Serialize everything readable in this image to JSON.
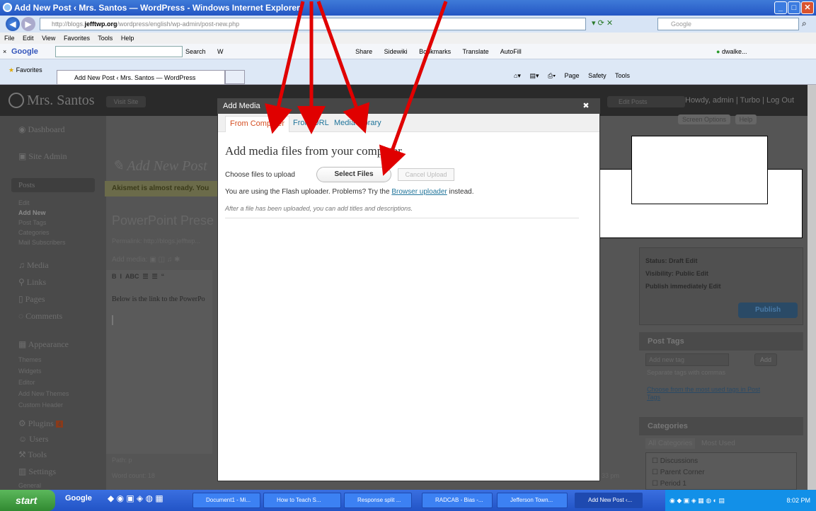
{
  "window": {
    "title": "Add New Post ‹ Mrs. Santos — WordPress - Windows Internet Explorer"
  },
  "address": {
    "prefix": "http://blogs.",
    "domain": "jefftwp.org",
    "path": "/wordpress/english/wp-admin/post-new.php",
    "search_placeholder": "Google"
  },
  "menu": [
    "File",
    "Edit",
    "View",
    "Favorites",
    "Tools",
    "Help"
  ],
  "google_toolbar": {
    "logo": "Google",
    "items": [
      "Search",
      "W",
      "Share",
      "Sidewiki",
      "Bookmarks",
      "Translate",
      "AutoFill"
    ],
    "user": "dwalke..."
  },
  "favorites": {
    "label": "Favorites",
    "tab": "Add New Post ‹ Mrs. Santos — WordPress",
    "commands": [
      "Page",
      "Safety",
      "Tools"
    ]
  },
  "wp": {
    "site_name": "Mrs. Santos",
    "visit_site": "Visit Site",
    "edit_posts": "Edit Posts",
    "howdy": "Howdy, admin | Turbo | Log Out",
    "screen_options": "Screen Options",
    "help": "Help",
    "sidebar": {
      "dashboard": "Dashboard",
      "site_admin": "Site Admin",
      "posts": "Posts",
      "posts_sub": [
        "Edit",
        "Add New",
        "Post Tags",
        "Categories",
        "Mail Subscribers"
      ],
      "media": "Media",
      "links": "Links",
      "pages": "Pages",
      "comments": "Comments",
      "appearance": "Appearance",
      "appearance_sub": [
        "Themes",
        "Widgets",
        "Editor",
        "Add New Themes",
        "Custom Header"
      ],
      "plugins": "Plugins",
      "plugins_badge": "4",
      "users": "Users",
      "tools": "Tools",
      "settings": "Settings",
      "settings_sub": "General"
    },
    "page_heading": "Add New Post",
    "akismet": "Akismet is almost ready. You",
    "post_title": "PowerPoint Prese",
    "permalink": "Permalink: http://blogs.jefftwp...",
    "add_media": "Add media:",
    "editor_text": "Below is the link to the PowerPo",
    "path": "Path: p",
    "word_count": "Word count: 18",
    "time": "33 pm",
    "status": "Status: Draft Edit",
    "visibility": "Visibility: Public Edit",
    "publish_time": "Publish immediately Edit",
    "publish": "Publish",
    "post_tags": "Post Tags",
    "add_new_tag": "Add new tag",
    "add": "Add",
    "tag_hint": "Separate tags with commas",
    "tag_link": "Choose from the most used tags in Post Tags",
    "categories": "Categories",
    "cat_tabs": [
      "All Categories",
      "Most Used"
    ],
    "cat_items": [
      "Discussions",
      "Parent Corner",
      "Period 1"
    ]
  },
  "modal": {
    "title": "Add Media",
    "tabs": [
      "From Computer",
      "From URL",
      "Media Library"
    ],
    "heading": "Add media files from your computer",
    "choose": "Choose files to upload",
    "select_files": "Select Files",
    "cancel_upload": "Cancel Upload",
    "flash_msg_pre": "You are using the Flash uploader. Problems? Try the",
    "flash_link": "Browser uploader",
    "flash_msg_post": "instead.",
    "after_upload": "After a file has been uploaded, you can add titles and descriptions."
  },
  "taskbar": {
    "start": "start",
    "google": "Google",
    "items": [
      "Document1 - Mi...",
      "How to Teach S...",
      "Response split ...",
      "RADCAB - Bias -...",
      "Jefferson Town...",
      "Add New Post ‹..."
    ],
    "time": "8:02 PM"
  },
  "colors": {
    "annotation_arrow": "#e00000",
    "link": "#21759b",
    "active_tab": "#d54e21"
  }
}
